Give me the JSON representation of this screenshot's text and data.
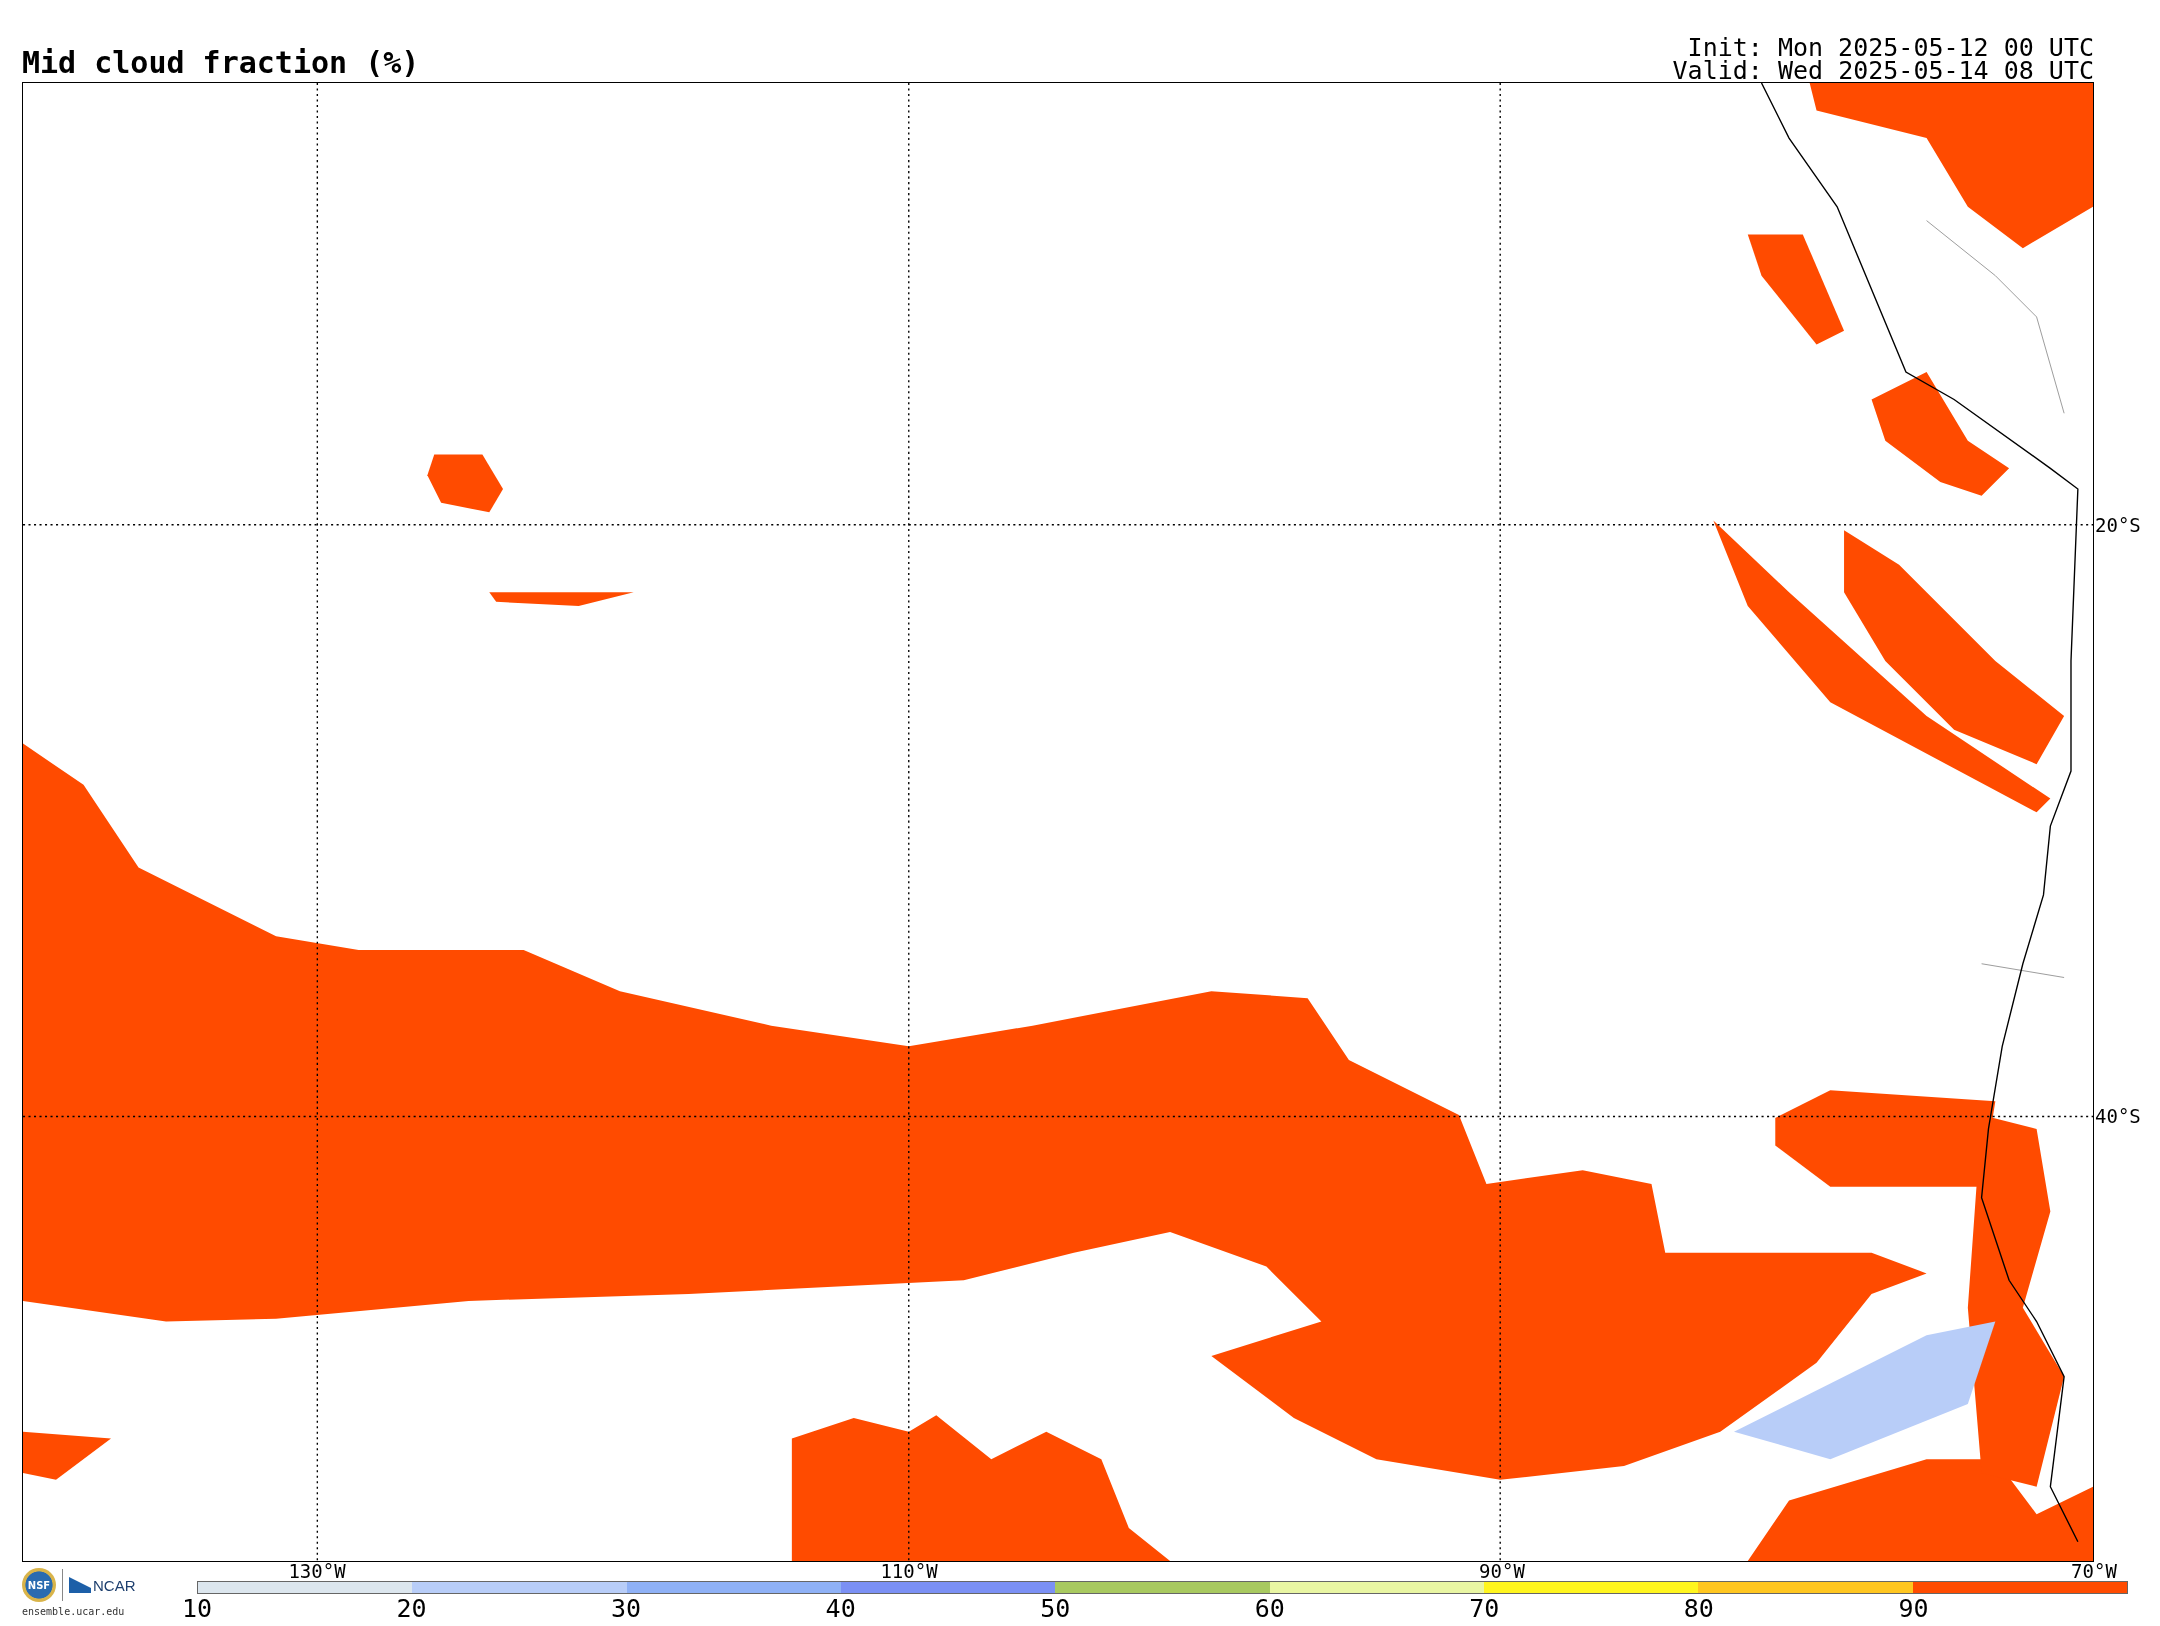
{
  "title": "Mid cloud fraction (%)",
  "init": "Init: Mon 2025-05-12 00 UTC",
  "valid": "Valid: Wed 2025-05-14 08 UTC",
  "map": {
    "lat_labels": [
      "20°S",
      "40°S"
    ],
    "lon_labels": [
      "130°W",
      "110°W",
      "90°W",
      "70°W"
    ]
  },
  "logos": {
    "seal": "NSF",
    "org": "NCAR",
    "site": "ensemble.ucar.edu"
  },
  "colorbar": {
    "ticks": [
      "10",
      "20",
      "30",
      "40",
      "50",
      "60",
      "70",
      "80",
      "90"
    ],
    "bins": [
      {
        "color": "#dce6ee"
      },
      {
        "color": "#b8cdf8"
      },
      {
        "color": "#8fb1f6"
      },
      {
        "color": "#7b90f4"
      },
      {
        "color": "#a8c960"
      },
      {
        "color": "#e9f6a3"
      },
      {
        "color": "#fff51e"
      },
      {
        "color": "#ffc620"
      },
      {
        "color": "#ff4b00"
      }
    ]
  }
}
